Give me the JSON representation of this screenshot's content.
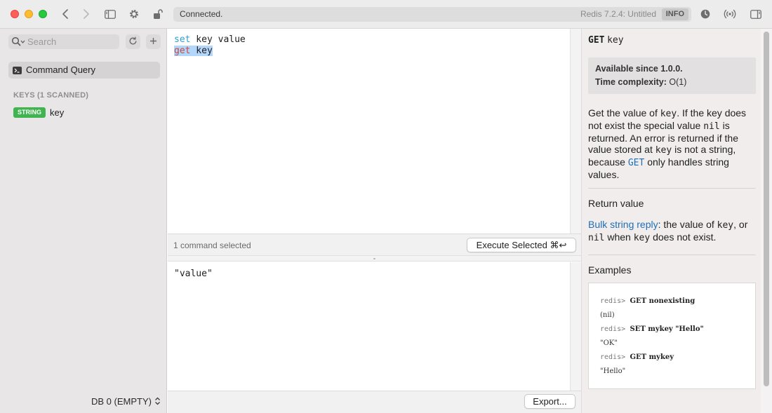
{
  "toolbar": {
    "status": "Connected.",
    "server": "Redis 7.2.4: Untitled",
    "info_badge": "INFO"
  },
  "sidebar": {
    "search_placeholder": "Search",
    "command_query_label": "Command Query",
    "keys_heading": "KEYS (1 SCANNED)",
    "keys": [
      {
        "type": "STRING",
        "name": "key",
        "type_color": "#3fb44f"
      }
    ],
    "db_label": "DB 0 (EMPTY)"
  },
  "editor": {
    "lines": [
      {
        "cmd": "set",
        "rest": " key value"
      },
      {
        "cmd": "get",
        "rest": " key"
      }
    ],
    "selection_status": "1 command selected",
    "execute_button": "Execute Selected ⌘↩"
  },
  "result": {
    "output": "\"value\"",
    "export_button": "Export..."
  },
  "doc": {
    "command": "GET",
    "arg": "key",
    "available_label": "Available since",
    "available_value": "1.0.0.",
    "complexity_label": "Time complexity:",
    "complexity_value": "O(1)",
    "summary": {
      "t1": "Get the value of ",
      "c1": "key",
      "t2": ". If the key does not exist the special value ",
      "c2": "nil",
      "t3": " is returned. An error is returned if the value stored at ",
      "c3": "key",
      "t4": " is not a string, because ",
      "c4": "GET",
      "t5": " only handles string values."
    },
    "return_heading": "Return value",
    "return": {
      "link": "Bulk string reply",
      "t1": ": the value of ",
      "c1": "key",
      "t2": ", or ",
      "c2": "nil",
      "t3": " when ",
      "c3": "key",
      "t4": " does not exist."
    },
    "examples_heading": "Examples",
    "examples": [
      {
        "prompt": "redis>",
        "cmd": "GET nonexisting"
      },
      {
        "out": "(nil)"
      },
      {
        "prompt": "redis>",
        "cmd": "SET mykey \"Hello\""
      },
      {
        "out": "\"OK\""
      },
      {
        "prompt": "redis>",
        "cmd": "GET mykey"
      },
      {
        "out": "\"Hello\""
      }
    ]
  }
}
